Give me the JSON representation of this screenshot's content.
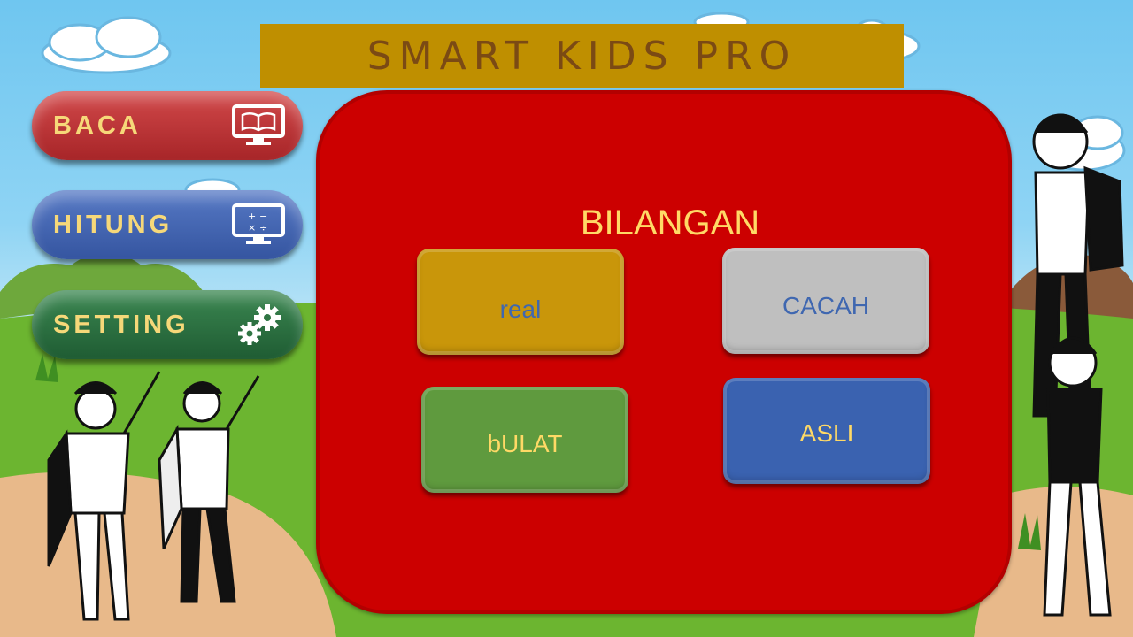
{
  "app": {
    "title": "SMART KIDS PRO"
  },
  "sidebar": {
    "items": [
      {
        "label": "BACA",
        "icon": "book-monitor-icon"
      },
      {
        "label": "HITUNG",
        "icon": "calculator-monitor-icon"
      },
      {
        "label": "SETTING",
        "icon": "gears-icon"
      }
    ]
  },
  "main": {
    "heading": "BILANGAN",
    "options": [
      {
        "label": "real"
      },
      {
        "label": "CACAH"
      },
      {
        "label": "bULAT"
      },
      {
        "label": "ASLI"
      }
    ]
  },
  "colors": {
    "title_bar": "#bf8f00",
    "panel": "#cc0000",
    "baca": "#c0393b",
    "hitung": "#4a6cb8",
    "setting": "#2f7543",
    "accent_text": "#ffd966"
  }
}
